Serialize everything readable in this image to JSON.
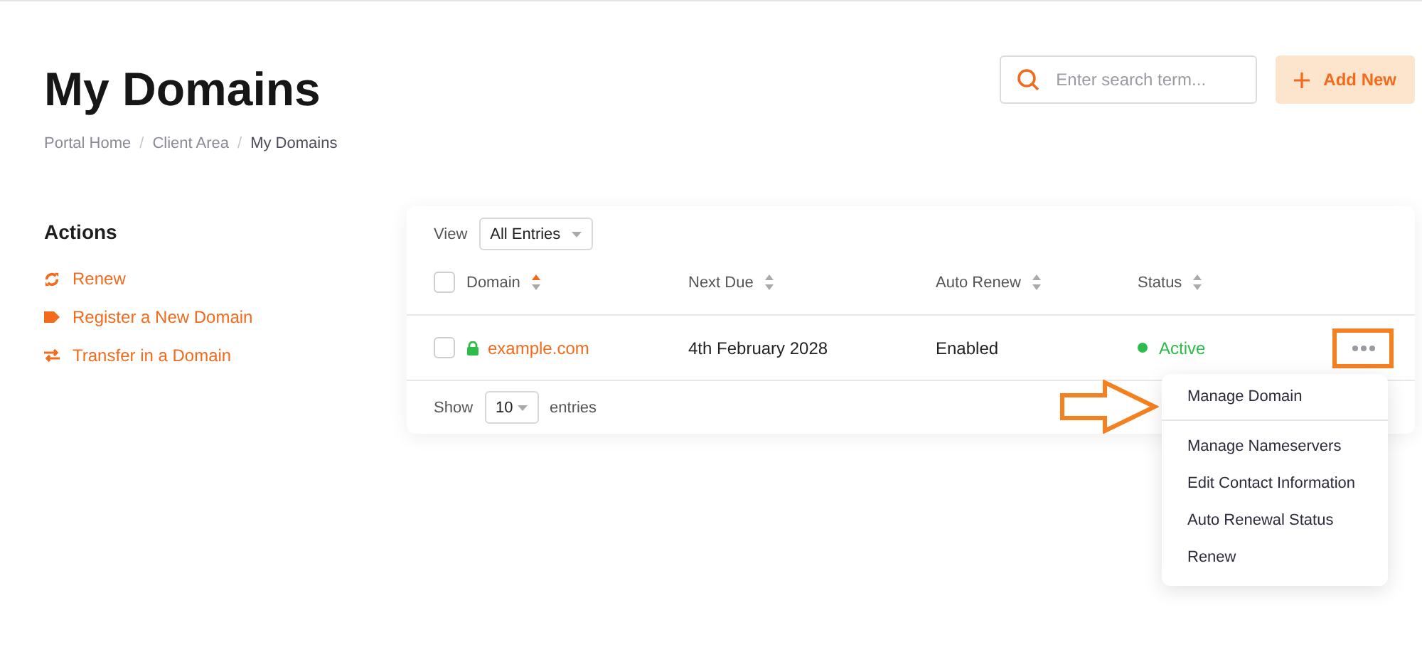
{
  "page": {
    "title": "My Domains",
    "breadcrumb_separator": "/",
    "breadcrumb": [
      {
        "label": "Portal Home",
        "current": false
      },
      {
        "label": "Client Area",
        "current": false
      },
      {
        "label": "My Domains",
        "current": true
      }
    ]
  },
  "search": {
    "placeholder": "Enter search term..."
  },
  "add_button": {
    "label": "Add New"
  },
  "sidebar": {
    "title": "Actions",
    "items": [
      {
        "label": "Renew",
        "kind": "renew"
      },
      {
        "label": "Register a New Domain",
        "kind": "tag"
      },
      {
        "label": "Transfer in a Domain",
        "kind": "transfer"
      }
    ]
  },
  "table": {
    "view_label": "View",
    "view_value": "All Entries",
    "select_all_checked": false,
    "columns": [
      {
        "label": "Domain",
        "sorted": true
      },
      {
        "label": "Next Due",
        "sorted": false
      },
      {
        "label": "Auto Renew",
        "sorted": false
      },
      {
        "label": "Status",
        "sorted": false
      }
    ],
    "rows": [
      {
        "checked": false,
        "secure": true,
        "domain": "example.com",
        "next_due": "4th February 2028",
        "auto_renew": "Enabled",
        "status": "Active",
        "color": "#2dbb4a"
      }
    ],
    "footer": {
      "show_label": "Show",
      "page_size": "10",
      "entries_label": "entries"
    }
  },
  "menu": {
    "items": [
      {
        "label": "Manage Domain",
        "divider_after": true
      },
      {
        "label": "Manage Nameservers",
        "divider_after": false
      },
      {
        "label": "Edit Contact Information",
        "divider_after": false
      },
      {
        "label": "Auto Renewal Status",
        "divider_after": false
      },
      {
        "label": "Renew",
        "divider_after": false
      }
    ]
  }
}
